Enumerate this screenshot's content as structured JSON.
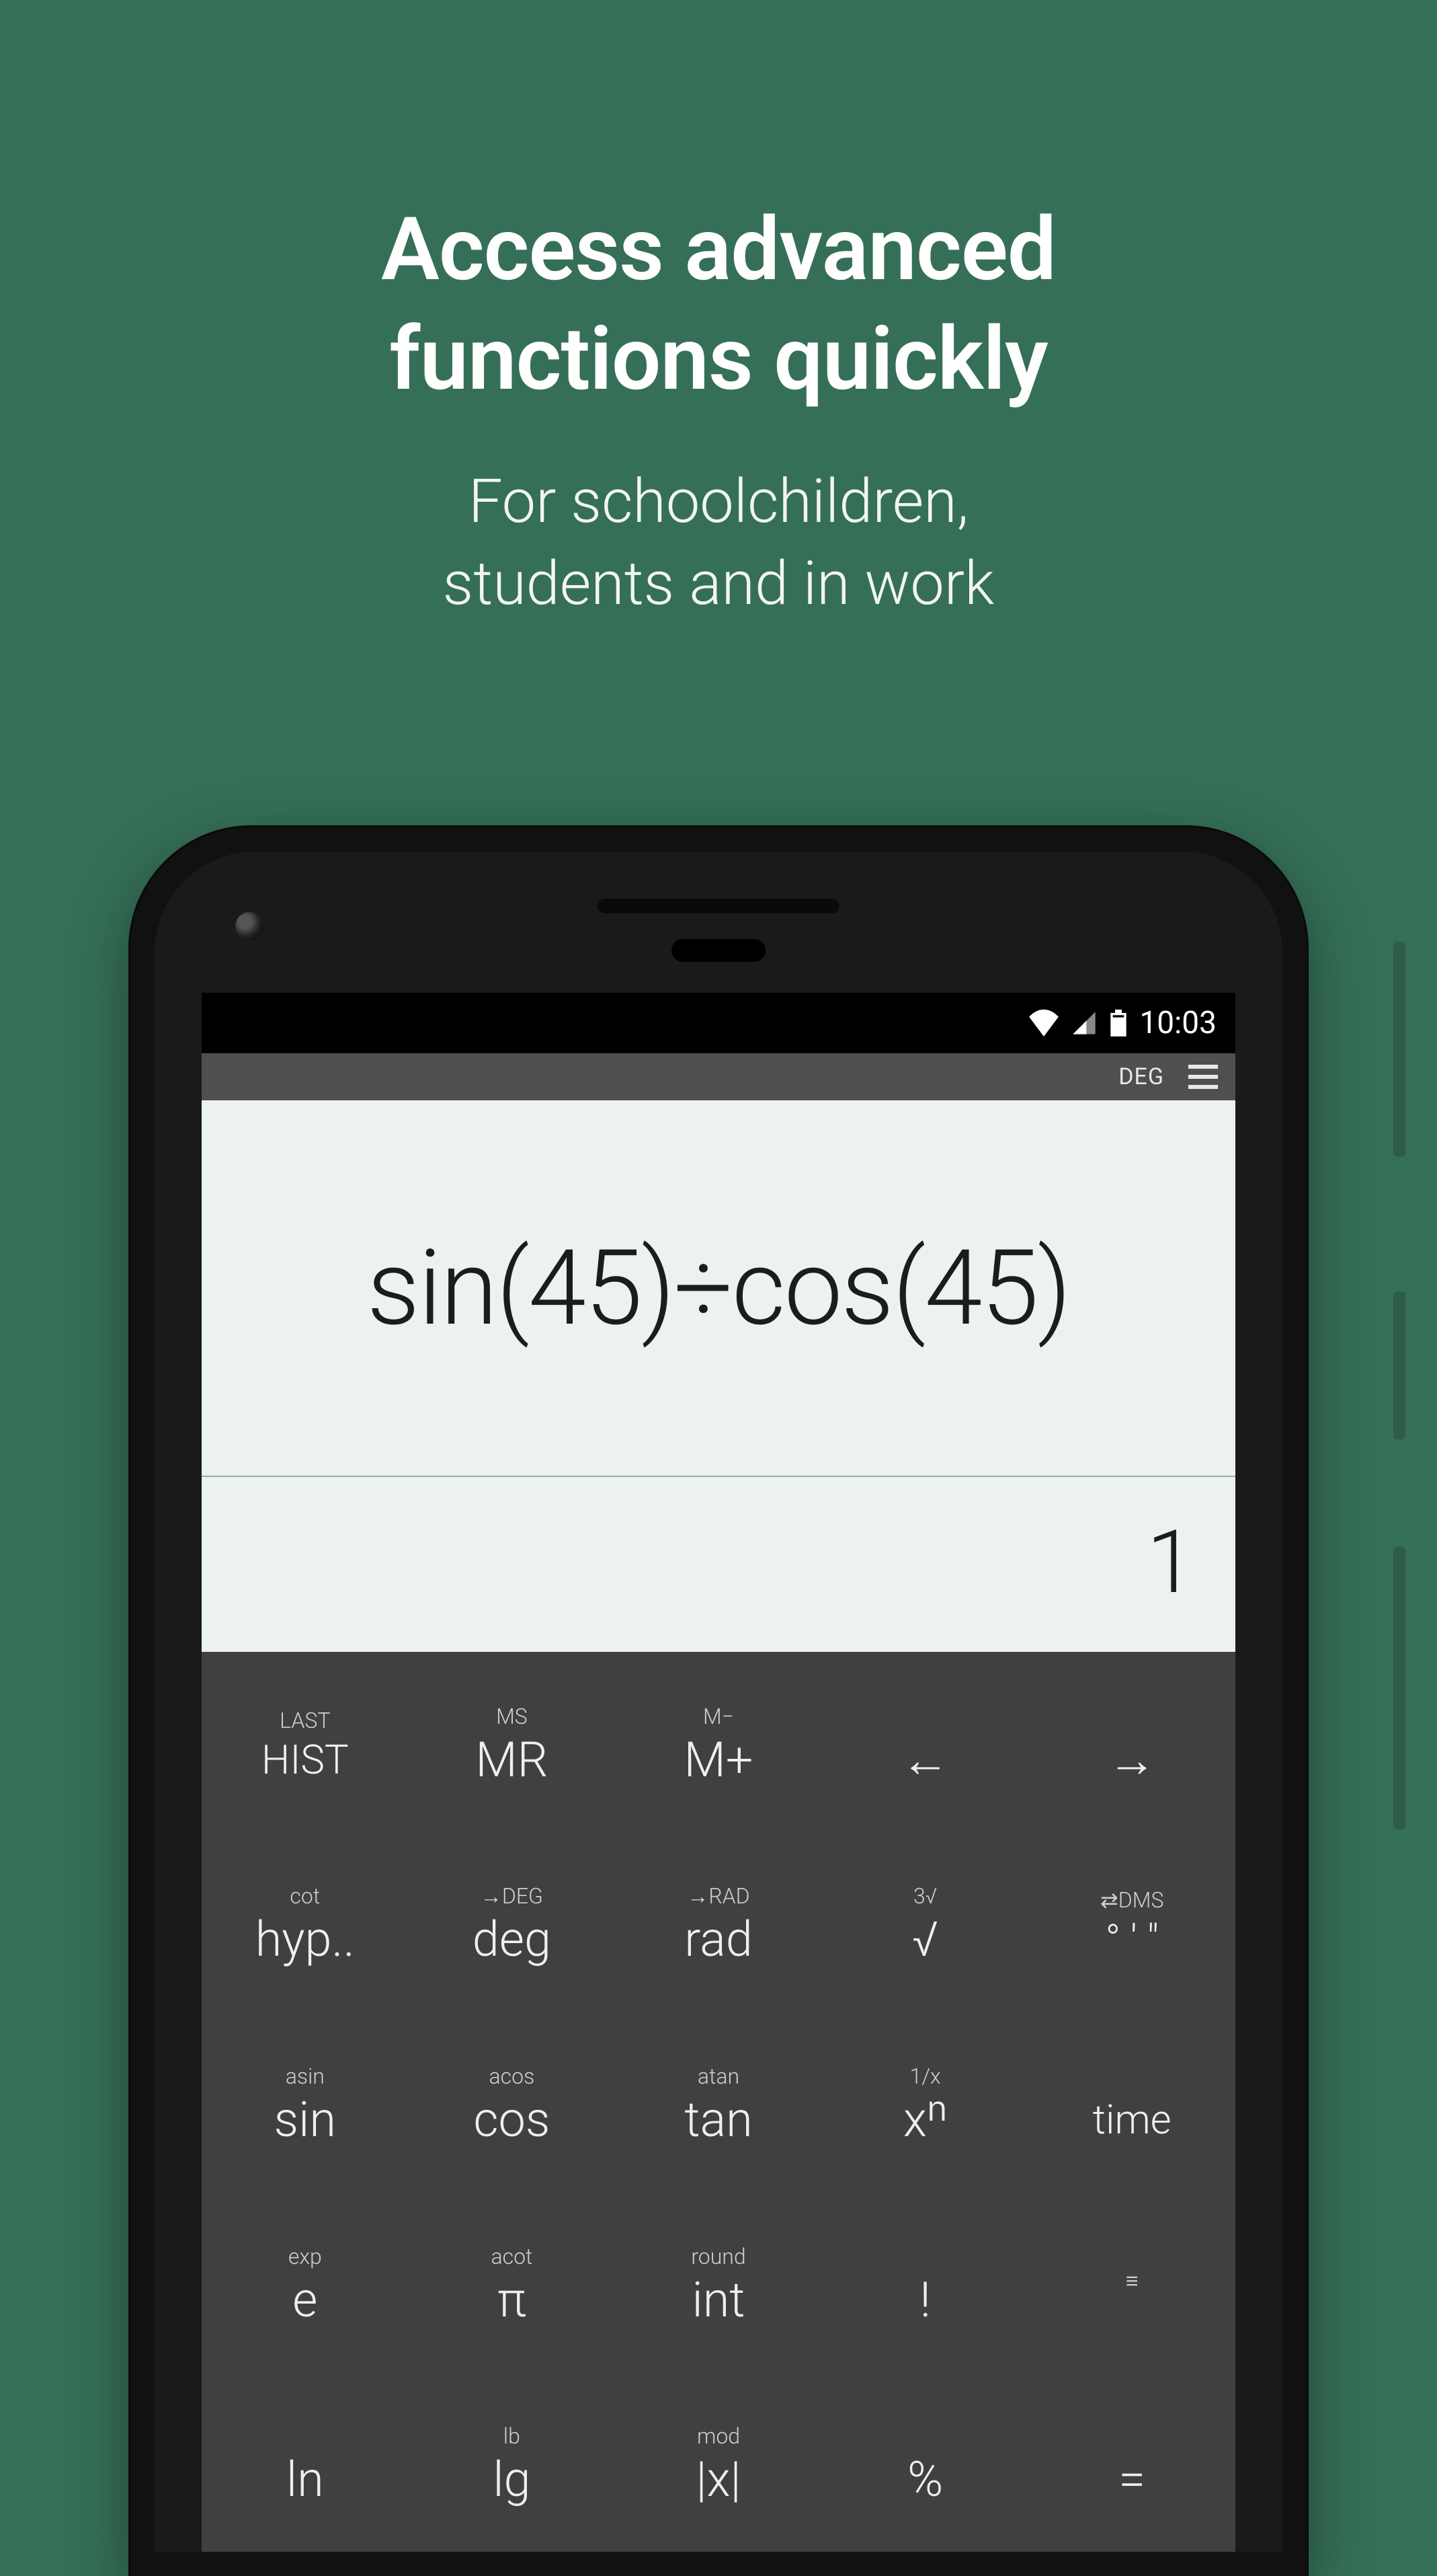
{
  "hero": {
    "title_line1": "Access advanced",
    "title_line2": "functions quickly",
    "sub_line1": "For schoolchildren,",
    "sub_line2": "students and in work"
  },
  "status": {
    "time": "10:03"
  },
  "appbar": {
    "angle_mode": "DEG"
  },
  "display": {
    "expression": "sin(45)÷cos(45)",
    "result": "1"
  },
  "keys": {
    "r0": [
      {
        "alt": "LAST",
        "main": "HIST"
      },
      {
        "alt": "MS",
        "main": "MR"
      },
      {
        "alt": "M−",
        "main": "M+"
      },
      {
        "alt": "",
        "main": "←"
      },
      {
        "alt": "",
        "main": "→"
      }
    ],
    "r1": [
      {
        "alt": "cot",
        "main": "hyp.."
      },
      {
        "alt": "→DEG",
        "main": "deg"
      },
      {
        "alt": "→RAD",
        "main": "rad"
      },
      {
        "alt": "3√",
        "main": "√"
      },
      {
        "alt": "⇄DMS",
        "main": "° ' \""
      }
    ],
    "r2": [
      {
        "alt": "asin",
        "main": "sin"
      },
      {
        "alt": "acos",
        "main": "cos"
      },
      {
        "alt": "atan",
        "main": "tan"
      },
      {
        "alt": "1/x",
        "main": "xⁿ"
      },
      {
        "alt": "",
        "main": "time"
      }
    ],
    "r3": [
      {
        "alt": "exp",
        "main": "e"
      },
      {
        "alt": "acot",
        "main": "π"
      },
      {
        "alt": "round",
        "main": "int"
      },
      {
        "alt": "",
        "main": "!"
      },
      {
        "alt": "≡",
        "main": ""
      }
    ],
    "r4": [
      {
        "alt": "",
        "main": "ln"
      },
      {
        "alt": "lb",
        "main": "lg"
      },
      {
        "alt": "mod",
        "main": "|x|"
      },
      {
        "alt": "",
        "main": "%"
      },
      {
        "alt": "",
        "main": "="
      }
    ]
  }
}
